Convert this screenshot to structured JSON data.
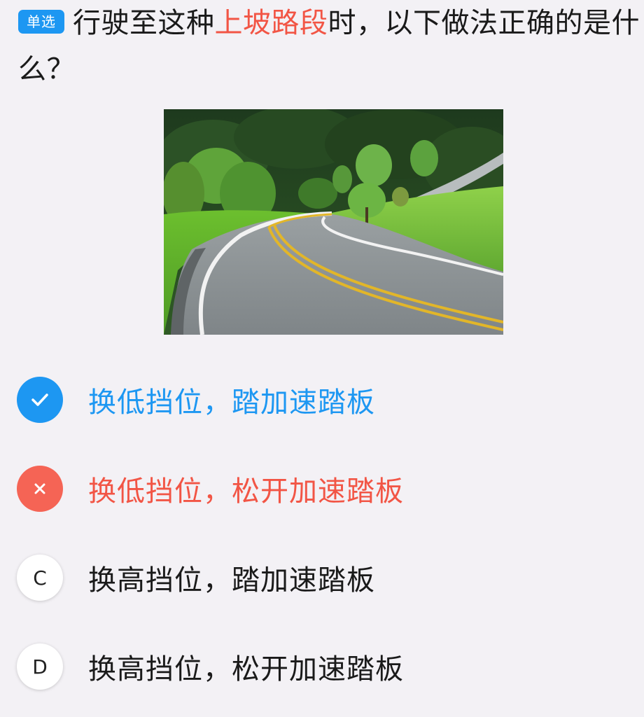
{
  "question": {
    "type_badge": "单选",
    "text_before": "行驶至这种",
    "keyword": "上坡路段",
    "text_after": "时，以下做法正确的是什么？"
  },
  "options": [
    {
      "letter": "A",
      "text": "换低挡位，踏加速踏板",
      "state": "correct",
      "icon": "check-icon"
    },
    {
      "letter": "B",
      "text": "换低挡位，松开加速踏板",
      "state": "wrong",
      "icon": "close-icon"
    },
    {
      "letter": "C",
      "text": "换高挡位，踏加速踏板",
      "state": "unselected"
    },
    {
      "letter": "D",
      "text": "换高挡位，松开加速踏板",
      "state": "unselected"
    }
  ],
  "colors": {
    "correct": "#1d97f2",
    "wrong": "#f25545",
    "keyword": "#f25545",
    "background": "#f3f1f5"
  }
}
